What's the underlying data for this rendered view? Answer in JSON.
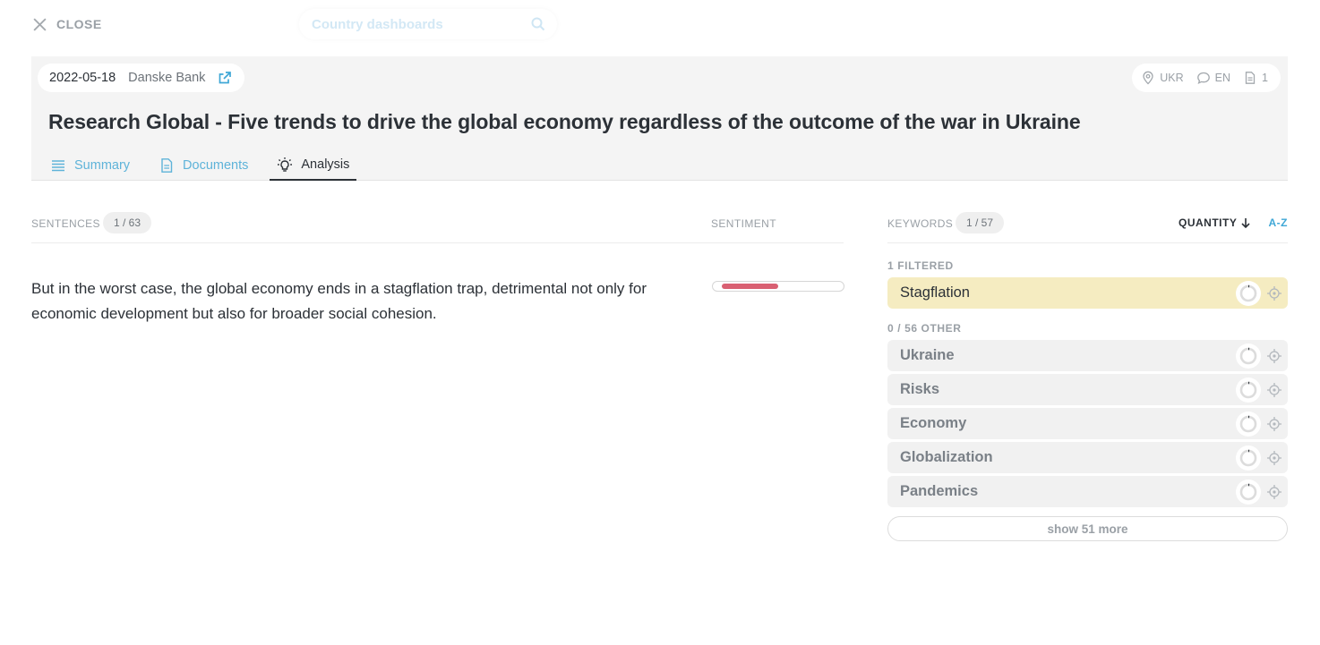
{
  "topbar": {
    "close_label": "CLOSE",
    "search_placeholder": "Country dashboards"
  },
  "header": {
    "date": "2022-05-18",
    "source": "Danske Bank",
    "country": "UKR",
    "language": "EN",
    "document_count": "1",
    "title": "Research Global - Five trends to drive the global economy regardless of the outcome of the war in Ukraine",
    "tabs": [
      {
        "label": "Summary",
        "icon": "list-icon"
      },
      {
        "label": "Documents",
        "icon": "document-icon"
      },
      {
        "label": "Analysis",
        "icon": "lightbulb-icon",
        "active": true
      }
    ]
  },
  "sentences": {
    "label": "SENTENCES",
    "count": "1 / 63",
    "sentiment_label": "SENTIMENT",
    "items": [
      {
        "text": "But in the worst case, the global economy ends in a stagflation trap, detrimental not only for economic development but also for broader social cohesion.",
        "sentiment_fraction": 0.43,
        "sentiment_color": "#d96072"
      }
    ]
  },
  "keywords": {
    "label": "KEYWORDS",
    "count": "1 / 57",
    "sort_quantity": "QUANTITY",
    "sort_az": "A-Z",
    "filtered_label": "1  FILTERED",
    "other_label": "0 / 56  OTHER",
    "filtered": [
      {
        "name": "Stagflation",
        "share": 0.02
      }
    ],
    "other": [
      {
        "name": "Ukraine",
        "share": 0.02
      },
      {
        "name": "Risks",
        "share": 0.02
      },
      {
        "name": "Economy",
        "share": 0.02
      },
      {
        "name": "Globalization",
        "share": 0.02
      },
      {
        "name": "Pandemics",
        "share": 0.02
      }
    ],
    "show_more": "show 51 more"
  },
  "colors": {
    "accent": "#3fa7d6",
    "tab_link": "#5eb3d9",
    "selected_keyword_bg": "#f5ecc1",
    "negative_sentiment": "#d96072"
  }
}
